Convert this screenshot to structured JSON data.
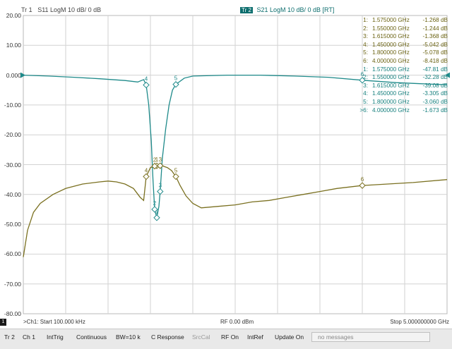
{
  "traces": {
    "tr1": {
      "label": "Tr 1",
      "desc": "S11 LogM 10 dB/ 0 dB"
    },
    "tr2": {
      "active_tag": "Tr 2",
      "desc": "S21 LogM 10 dB/ 0 dB [RT]"
    }
  },
  "y_axis": {
    "ticks": [
      "20.00",
      "10.00",
      "0.000",
      "-10.00",
      "-20.00",
      "-30.00",
      "-40.00",
      "-50.00",
      "-60.00",
      "-70.00",
      "-80.00"
    ]
  },
  "marker_table": {
    "rows": [
      {
        "id": "1:",
        "freq": "1.575000 GHz",
        "value": "-1.268 dB",
        "trace": "s11"
      },
      {
        "id": "2:",
        "freq": "1.550000 GHz",
        "value": "-1.244 dB",
        "trace": "s11"
      },
      {
        "id": "3:",
        "freq": "1.615000 GHz",
        "value": "-1.368 dB",
        "trace": "s11"
      },
      {
        "id": "4:",
        "freq": "1.450000 GHz",
        "value": "-5.042 dB",
        "trace": "s11"
      },
      {
        "id": "5:",
        "freq": "1.800000 GHz",
        "value": "-5.078 dB",
        "trace": "s11"
      },
      {
        "id": "6:",
        "freq": "4.000000 GHz",
        "value": "-8.418 dB",
        "trace": "s11"
      },
      {
        "id": "1:",
        "freq": "1.575000 GHz",
        "value": "-47.81 dB",
        "trace": "s21"
      },
      {
        "id": "2:",
        "freq": "1.550000 GHz",
        "value": "-32.28 dB",
        "trace": "s21"
      },
      {
        "id": "3:",
        "freq": "1.615000 GHz",
        "value": "-39.08 dB",
        "trace": "s21"
      },
      {
        "id": "4:",
        "freq": "1.450000 GHz",
        "value": "-3.305 dB",
        "trace": "s21"
      },
      {
        "id": "5:",
        "freq": "1.800000 GHz",
        "value": "-3.060 dB",
        "trace": "s21"
      },
      {
        "id": ">6:",
        "freq": "4.000000 GHz",
        "value": "-1.673 dB",
        "trace": "s21"
      }
    ]
  },
  "chart_data": {
    "type": "line",
    "ylim": [
      -80,
      20
    ],
    "y_unit": "dB",
    "x_unit": "GHz",
    "xlim": [
      0.0001,
      5.0
    ],
    "series": [
      {
        "name": "S11",
        "color": "#7a7020",
        "points": [
          [
            0.0001,
            -61
          ],
          [
            0.05,
            -52
          ],
          [
            0.12,
            -46
          ],
          [
            0.2,
            -43
          ],
          [
            0.35,
            -40
          ],
          [
            0.5,
            -38
          ],
          [
            0.7,
            -36.5
          ],
          [
            0.9,
            -35.8
          ],
          [
            1.0,
            -35.5
          ],
          [
            1.1,
            -35.8
          ],
          [
            1.2,
            -36.5
          ],
          [
            1.3,
            -38
          ],
          [
            1.38,
            -41
          ],
          [
            1.42,
            -42
          ],
          [
            1.45,
            -34
          ],
          [
            1.5,
            -31
          ],
          [
            1.55,
            -30.5
          ],
          [
            1.6,
            -30.3
          ],
          [
            1.65,
            -30.5
          ],
          [
            1.7,
            -31
          ],
          [
            1.75,
            -32
          ],
          [
            1.8,
            -34
          ],
          [
            1.85,
            -37
          ],
          [
            1.92,
            -40.5
          ],
          [
            2.0,
            -43
          ],
          [
            2.1,
            -44.5
          ],
          [
            2.3,
            -44
          ],
          [
            2.5,
            -43.5
          ],
          [
            2.7,
            -42.5
          ],
          [
            2.9,
            -42
          ],
          [
            3.1,
            -41
          ],
          [
            3.3,
            -40
          ],
          [
            3.5,
            -39
          ],
          [
            3.7,
            -38
          ],
          [
            4.0,
            -37
          ],
          [
            4.3,
            -36.5
          ],
          [
            4.6,
            -36
          ],
          [
            5.0,
            -35
          ]
        ]
      },
      {
        "name": "S21",
        "color": "#1e8a8a",
        "points": [
          [
            0.0001,
            0
          ],
          [
            0.3,
            -0.3
          ],
          [
            0.6,
            -0.7
          ],
          [
            0.9,
            -1.2
          ],
          [
            1.2,
            -1.8
          ],
          [
            1.35,
            -2.3
          ],
          [
            1.42,
            -1.5
          ],
          [
            1.45,
            -3.3
          ],
          [
            1.48,
            -10
          ],
          [
            1.51,
            -22
          ],
          [
            1.53,
            -35
          ],
          [
            1.55,
            -45
          ],
          [
            1.575,
            -47.8
          ],
          [
            1.6,
            -44
          ],
          [
            1.615,
            -39
          ],
          [
            1.64,
            -28
          ],
          [
            1.68,
            -18
          ],
          [
            1.72,
            -10
          ],
          [
            1.76,
            -5
          ],
          [
            1.8,
            -3.1
          ],
          [
            1.9,
            -1
          ],
          [
            2.0,
            -0.3
          ],
          [
            2.4,
            0
          ],
          [
            2.8,
            0
          ],
          [
            3.2,
            -0.3
          ],
          [
            3.6,
            -0.7
          ],
          [
            4.0,
            -1.7
          ],
          [
            4.4,
            -2.5
          ],
          [
            4.8,
            -3
          ],
          [
            5.0,
            -3.2
          ]
        ]
      }
    ],
    "markers": {
      "s11": [
        {
          "label": "1",
          "x": 1.575,
          "y": -1.268
        },
        {
          "label": "2",
          "x": 1.55,
          "y": -1.244
        },
        {
          "label": "3",
          "x": 1.615,
          "y": -1.368
        },
        {
          "label": "4",
          "x": 1.45,
          "y": -5.042
        },
        {
          "label": "5",
          "x": 1.8,
          "y": -5.078
        },
        {
          "label": "6",
          "x": 4.0,
          "y": -8.418
        }
      ],
      "s21": [
        {
          "label": "1",
          "x": 1.575,
          "y": -47.81
        },
        {
          "label": "2",
          "x": 1.55,
          "y": -32.28
        },
        {
          "label": "3",
          "x": 1.615,
          "y": -39.08
        },
        {
          "label": "4",
          "x": 1.45,
          "y": -3.305
        },
        {
          "label": "5",
          "x": 1.8,
          "y": -3.06
        },
        {
          "label": "6",
          "x": 4.0,
          "y": -1.673
        }
      ]
    },
    "reference_level": 0
  },
  "status": {
    "channel_badge": "1",
    "start": ">Ch1: Start 100.000 kHz",
    "power": "RF 0.00 dBm",
    "stop": "Stop 5.000000000 GHz"
  },
  "softkeys": [
    {
      "label": "Tr 2",
      "enabled": true
    },
    {
      "label": "Ch 1",
      "enabled": true
    },
    {
      "label": "IntTrig",
      "enabled": true
    },
    {
      "label": "Continuous",
      "enabled": true
    },
    {
      "label": "BW=10 k",
      "enabled": true
    },
    {
      "label": "C Response",
      "enabled": true
    },
    {
      "label": "SrcCal",
      "enabled": false
    },
    {
      "label": "RF On",
      "enabled": true
    },
    {
      "label": "IntRef",
      "enabled": true
    },
    {
      "label": "Update On",
      "enabled": true
    },
    {
      "label": "no messages",
      "enabled": false
    }
  ]
}
